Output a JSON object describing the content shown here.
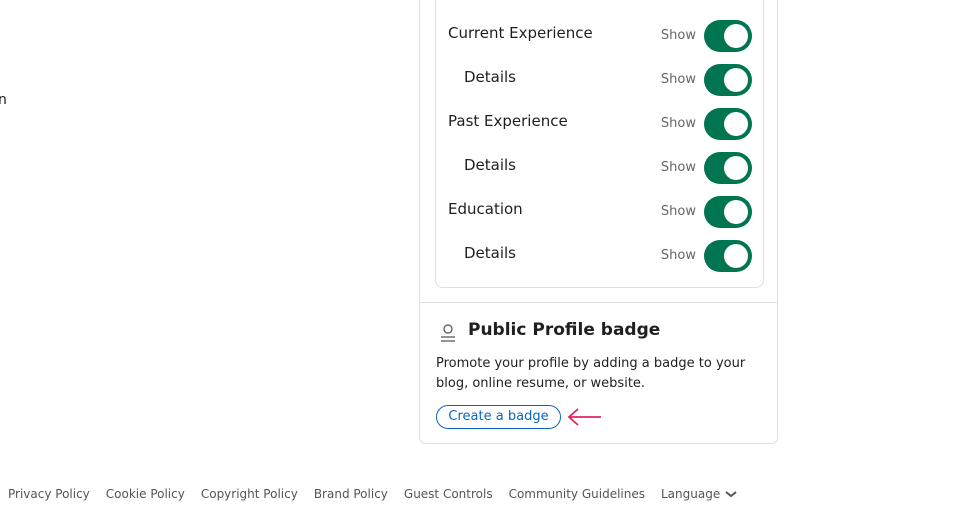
{
  "left_fragment": "n",
  "visibility": {
    "rows": [
      {
        "label": "Current Experience",
        "status": "Show",
        "indent": false
      },
      {
        "label": "Details",
        "status": "Show",
        "indent": true
      },
      {
        "label": "Past Experience",
        "status": "Show",
        "indent": false
      },
      {
        "label": "Details",
        "status": "Show",
        "indent": true
      },
      {
        "label": "Education",
        "status": "Show",
        "indent": false
      },
      {
        "label": "Details",
        "status": "Show",
        "indent": true
      }
    ],
    "toggle_color": "#01754f"
  },
  "badge": {
    "icon": "person-icon",
    "title": "Public Profile badge",
    "description": "Promote your profile by adding a badge to your blog, online resume, or website.",
    "button_label": "Create a badge",
    "arrow_color": "#e0245e"
  },
  "footer": {
    "links": [
      "Privacy Policy",
      "Cookie Policy",
      "Copyright Policy",
      "Brand Policy",
      "Guest Controls",
      "Community Guidelines"
    ],
    "language_label": "Language"
  },
  "accent_color": "#0a66c2"
}
